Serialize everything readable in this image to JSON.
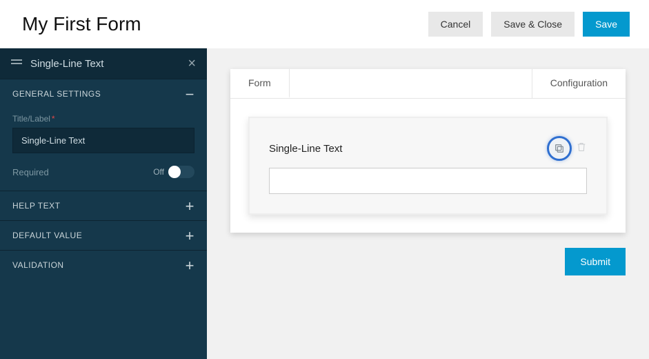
{
  "topbar": {
    "title": "My First Form",
    "cancel_label": "Cancel",
    "save_close_label": "Save & Close",
    "save_label": "Save"
  },
  "sidebar": {
    "header_title": "Single-Line Text",
    "sections": {
      "general": {
        "heading": "General Settings",
        "open": true,
        "title_label": "Title/Label",
        "title_value": "Single-Line Text",
        "required_label": "Required",
        "required_state": "Off"
      },
      "help_text": {
        "heading": "Help Text"
      },
      "default_value": {
        "heading": "Default Value"
      },
      "validation": {
        "heading": "Validation"
      }
    }
  },
  "canvas": {
    "tabs": {
      "form": "Form",
      "configuration": "Configuration"
    },
    "field": {
      "label": "Single-Line Text",
      "value": ""
    },
    "submit_label": "Submit"
  }
}
